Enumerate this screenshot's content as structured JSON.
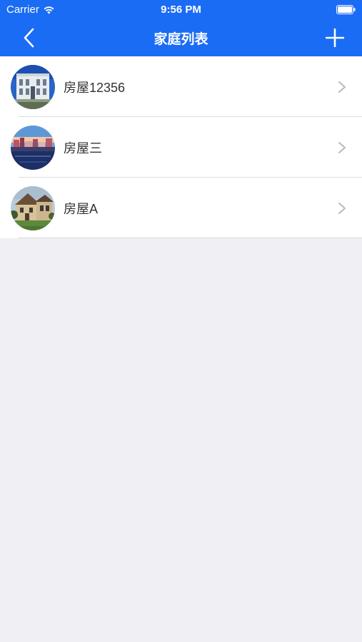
{
  "status_bar": {
    "carrier": "Carrier",
    "time": "9:56 PM"
  },
  "nav": {
    "title": "家庭列表",
    "back_icon": "chevron-left-icon",
    "add_icon": "plus-icon"
  },
  "houses": [
    {
      "name": "房屋12356",
      "image": "house-photo"
    },
    {
      "name": "房屋三",
      "image": "city-harbor-photo"
    },
    {
      "name": "房屋A",
      "image": "villa-photo"
    }
  ],
  "colors": {
    "header_bg": "#1a6cf5",
    "page_bg": "#efeff4",
    "list_bg": "#ffffff"
  }
}
